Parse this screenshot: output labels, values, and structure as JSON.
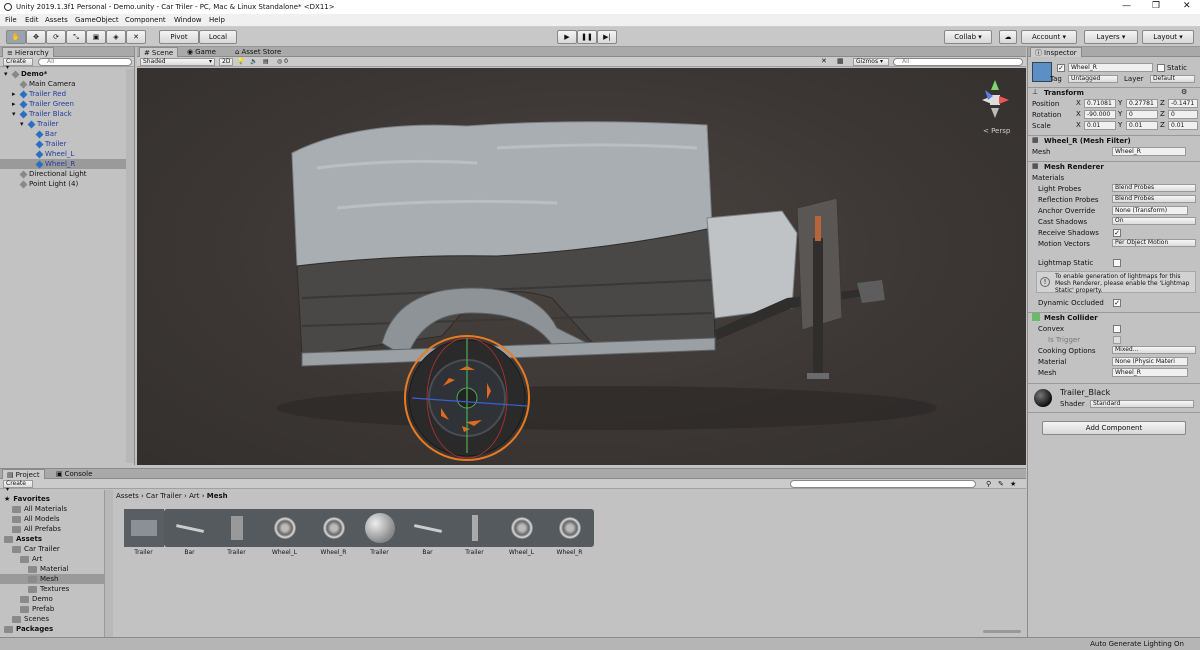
{
  "window": {
    "title": "Unity 2019.1.3f1 Personal - Demo.unity - Car Triler - PC, Mac & Linux Standalone* <DX11>",
    "controls": [
      "—",
      "❐",
      "✕"
    ]
  },
  "menu": [
    "File",
    "Edit",
    "Assets",
    "GameObject",
    "Component",
    "Window",
    "Help"
  ],
  "toolbar": {
    "pivot": "Pivot",
    "local": "Local",
    "collab": "Collab",
    "account": "Account",
    "layers": "Layers",
    "layout": "Layout"
  },
  "hierarchy": {
    "tab": "Hierarchy",
    "create": "Create",
    "search_placeholder": "All",
    "items": [
      {
        "label": "Demo*",
        "depth": 0,
        "color": "#111111"
      },
      {
        "label": "Main Camera",
        "depth": 1,
        "color": "#111111"
      },
      {
        "label": "Trailer Red",
        "depth": 1,
        "color": "#1f3f9c"
      },
      {
        "label": "Trailer Green",
        "depth": 1,
        "color": "#1f3f9c"
      },
      {
        "label": "Trailer Black",
        "depth": 1,
        "color": "#1f3f9c"
      },
      {
        "label": "Trailer",
        "depth": 2,
        "color": "#1f3f9c"
      },
      {
        "label": "Bar",
        "depth": 3,
        "color": "#1f3f9c"
      },
      {
        "label": "Trailer",
        "depth": 3,
        "color": "#1f3f9c"
      },
      {
        "label": "Wheel_L",
        "depth": 3,
        "color": "#1f3f9c"
      },
      {
        "label": "Wheel_R",
        "depth": 3,
        "color": "#1f3f9c"
      },
      {
        "label": "Directional Light",
        "depth": 1,
        "color": "#111111"
      },
      {
        "label": "Point Light (4)",
        "depth": 1,
        "color": "#111111"
      }
    ]
  },
  "scene": {
    "tabs": [
      "Scene",
      "Game",
      "Asset Store"
    ],
    "shading": "Shaded",
    "mode2d": "2D",
    "fx_count": "0",
    "gizmos": "Gizmos",
    "search_placeholder": "All",
    "persp": "< Persp"
  },
  "inspector": {
    "tab": "Inspector",
    "object_name": "Wheel_R",
    "static_label": "Static",
    "tag_label": "Tag",
    "tag": "Untagged",
    "layer_label": "Layer",
    "layer": "Default",
    "transform": {
      "title": "Transform",
      "position": {
        "label": "Position",
        "x": "0.71081",
        "y": "0.27781",
        "z": "-0.1471"
      },
      "rotation": {
        "label": "Rotation",
        "x": "-90.000",
        "y": "0",
        "z": "0"
      },
      "scale": {
        "label": "Scale",
        "x": "0.01",
        "y": "0.01",
        "z": "0.01"
      }
    },
    "mesh_filter": {
      "title": "Wheel_R (Mesh Filter)",
      "mesh_label": "Mesh",
      "mesh": "Wheel_R"
    },
    "mesh_renderer": {
      "title": "Mesh Renderer",
      "materials": "Materials",
      "light_probes_label": "Light Probes",
      "light_probes": "Blend Probes",
      "reflection_probes_label": "Reflection Probes",
      "reflection_probes": "Blend Probes",
      "anchor_label": "Anchor Override",
      "anchor": "None (Transform)",
      "cast_label": "Cast Shadows",
      "cast": "On",
      "receive_label": "Receive Shadows",
      "motion_label": "Motion Vectors",
      "motion": "Per Object Motion",
      "lightmap_label": "Lightmap Static",
      "info": "To enable generation of lightmaps for this Mesh Renderer, please enable the 'Lightmap Static' property.",
      "dynamic_label": "Dynamic Occluded"
    },
    "mesh_collider": {
      "title": "Mesh Collider",
      "convex": "Convex",
      "trigger": "Is Trigger",
      "cooking_label": "Cooking Options",
      "cooking": "Mixed...",
      "material_label": "Material",
      "material": "None (Physic Materi",
      "mesh_label": "Mesh",
      "mesh": "Wheel_R"
    },
    "material": {
      "name": "Trailer_Black",
      "shader_label": "Shader",
      "shader": "Standard"
    },
    "add_component": "Add Component"
  },
  "project": {
    "tabs": [
      "Project",
      "Console"
    ],
    "create": "Create",
    "tree": [
      {
        "label": "Favorites",
        "depth": 0,
        "bold": true,
        "star": true
      },
      {
        "label": "All Materials",
        "depth": 1
      },
      {
        "label": "All Models",
        "depth": 1
      },
      {
        "label": "All Prefabs",
        "depth": 1
      },
      {
        "label": "Assets",
        "depth": 0,
        "bold": true
      },
      {
        "label": "Car Trailer",
        "depth": 1
      },
      {
        "label": "Art",
        "depth": 2
      },
      {
        "label": "Material",
        "depth": 3
      },
      {
        "label": "Mesh",
        "depth": 3
      },
      {
        "label": "Textures",
        "depth": 3
      },
      {
        "label": "Demo",
        "depth": 2
      },
      {
        "label": "Prefab",
        "depth": 2
      },
      {
        "label": "Scenes",
        "depth": 1
      },
      {
        "label": "Packages",
        "depth": 0,
        "bold": true
      }
    ],
    "breadcrumb": [
      "Assets",
      "Car Trailer",
      "Art",
      "Mesh"
    ],
    "assets": [
      {
        "label": "Trailer",
        "icon": "trailer-model-icon"
      },
      {
        "label": "Bar",
        "icon": "bar-mesh-icon"
      },
      {
        "label": "Trailer",
        "icon": "trailer-mesh-icon"
      },
      {
        "label": "Wheel_L",
        "icon": "wheel-mesh-icon"
      },
      {
        "label": "Wheel_R",
        "icon": "wheel-mesh-icon"
      },
      {
        "label": "Trailer",
        "icon": "sphere-material-icon"
      },
      {
        "label": "Bar",
        "icon": "bar-mesh-icon"
      },
      {
        "label": "Trailer",
        "icon": "jack-mesh-icon"
      },
      {
        "label": "Wheel_L",
        "icon": "wheel-mesh-icon"
      },
      {
        "label": "Wheel_R",
        "icon": "wheel-mesh-icon"
      }
    ]
  },
  "status": {
    "text": "Auto Generate Lighting On"
  }
}
